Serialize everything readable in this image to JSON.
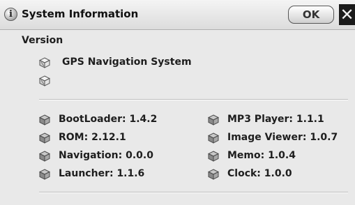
{
  "window": {
    "title": "System Information",
    "ok_label": "OK",
    "close_glyph": "✕",
    "info_glyph": "i"
  },
  "version": {
    "heading": "Version",
    "product_name": "GPS Navigation System",
    "product_line2": ""
  },
  "components": {
    "left": [
      {
        "label": "BootLoader: 1.4.2",
        "icon": "package-icon"
      },
      {
        "label": "ROM: 2.12.1",
        "icon": "package-icon"
      },
      {
        "label": "Navigation: 0.0.0",
        "icon": "package-icon"
      },
      {
        "label": "Launcher: 1.1.6",
        "icon": "package-icon"
      }
    ],
    "right": [
      {
        "label": "MP3 Player: 1.1.1",
        "icon": "package-icon"
      },
      {
        "label": "Image Viewer: 1.0.7",
        "icon": "package-icon"
      },
      {
        "label": "Memo: 1.0.4",
        "icon": "package-icon"
      },
      {
        "label": "Clock: 1.0.0",
        "icon": "package-icon"
      }
    ]
  },
  "colors": {
    "background": "#e9e9e9",
    "titlebar": "#dcdcdc",
    "close_bg": "#1b1b1b",
    "text": "#1e1e1e"
  }
}
